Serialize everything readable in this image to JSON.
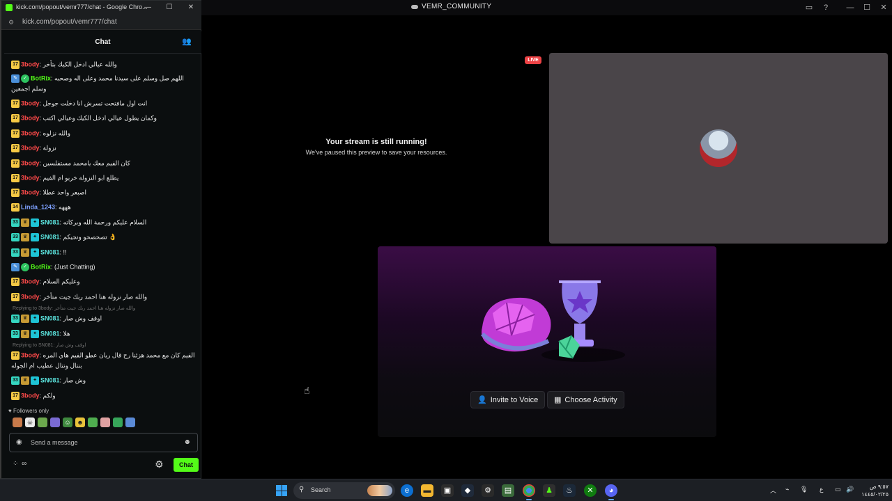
{
  "discord": {
    "window_title": "VEMR_COMMUNITY",
    "stream_title": "Your stream is still running!",
    "stream_subtitle": "We've paused this preview to save your resources.",
    "live_badge": "LIVE",
    "invite_label": "Invite to Voice",
    "activity_label": "Choose Activity"
  },
  "browser": {
    "title": "kick.com/popout/vemr777/chat - Google Chro...",
    "url": "kick.com/popout/vemr777/chat"
  },
  "chat": {
    "heading": "Chat",
    "followers_only": "Followers only",
    "input_placeholder": "Send a message",
    "send_label": "Chat",
    "bottom_left": "∞",
    "messages": [
      {
        "badges": [
          "17"
        ],
        "user": "3body",
        "text": "والله عيالي ادخل الكيك بتأخر"
      },
      {
        "badges": [
          "bot",
          "check"
        ],
        "user": "BotRix",
        "text": "اللهم صل وسلم على سيدنا محمد وعلى اله وصحبه وسلم اجمعين"
      },
      {
        "badges": [
          "17"
        ],
        "user": "3body",
        "text": "انت اول مافتحت تسرش انا دخلت جوجل"
      },
      {
        "badges": [
          "17"
        ],
        "user": "3body",
        "text": "وكمان يطول عيالي ادخل الكيك وعيالي اكتب"
      },
      {
        "badges": [
          "17"
        ],
        "user": "3body",
        "text": "والله نزلوه"
      },
      {
        "badges": [
          "17"
        ],
        "user": "3body",
        "text": "نزولة"
      },
      {
        "badges": [
          "17"
        ],
        "user": "3body",
        "text": "كان الفيم معك يامحمد مستفلسين"
      },
      {
        "badges": [
          "17"
        ],
        "user": "3body",
        "text": "يطلع ابو النزولة خربو ام الفيم"
      },
      {
        "badges": [
          "17"
        ],
        "user": "3body",
        "text": "اصبعر واحد عطلا"
      },
      {
        "badges": [
          "14"
        ],
        "user": "Linda_1243",
        "text": "هههه"
      },
      {
        "badges": [
          "33",
          "crown",
          "sub"
        ],
        "user": "SN081",
        "text": "السلام عليكم ورحمة الله وبركاته"
      },
      {
        "badges": [
          "33",
          "crown",
          "sub"
        ],
        "user": "SN081",
        "text": "تصحصحو ونجيكم 👌"
      },
      {
        "badges": [
          "33",
          "crown",
          "sub"
        ],
        "user": "SN081",
        "text": "!!"
      },
      {
        "badges": [
          "bot",
          "check"
        ],
        "user": "BotRix",
        "text": "(Just Chatting)"
      },
      {
        "badges": [
          "17"
        ],
        "user": "3body",
        "text": "وعليكم السلام"
      },
      {
        "badges": [
          "17"
        ],
        "user": "3body",
        "text": "والله صار نزوله هنا احمد ربك جيت متأخر"
      },
      {
        "badges": [
          "33",
          "crown",
          "sub"
        ],
        "user": "SN081",
        "text": "اوقف وش صار"
      },
      {
        "badges": [
          "33",
          "crown",
          "sub"
        ],
        "user": "SN081",
        "text": "هلا"
      },
      {
        "badges": [
          "17"
        ],
        "user": "3body",
        "text": "الفيم كان مع محمد هزئنا رح قال ريان عطو الفيم هاي المره بنتال ونتال عطيب ام الجوله"
      },
      {
        "badges": [
          "33",
          "crown",
          "sub"
        ],
        "user": "SN081",
        "text": "وش صار"
      },
      {
        "badges": [
          "17"
        ],
        "user": "3body",
        "text": "ولكم"
      }
    ],
    "replies": [
      "Replying to 3body: والله صار نزوله هنا احمد ربك جيت متأخر",
      "Replying to SN081: اوقف وش صار"
    ]
  },
  "taskbar": {
    "search_label": "Search",
    "clock_time": "٩:٥٧ ص",
    "clock_date": "١٤٤٥/٠٢/٢٥",
    "lang": "ع"
  },
  "colors": {
    "kick_green": "#53fc18",
    "username_red": "#ff4a4a",
    "live_red": "#ed4245"
  }
}
